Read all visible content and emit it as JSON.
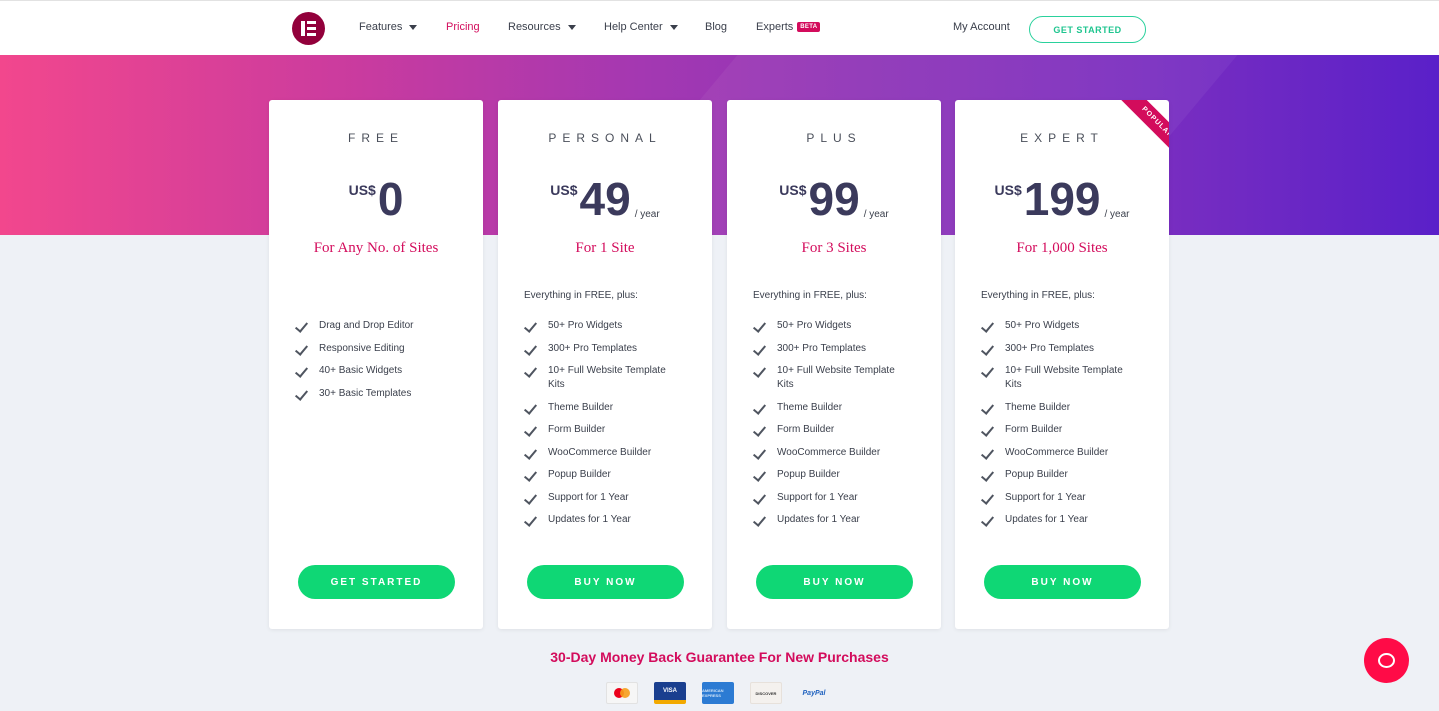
{
  "header": {
    "nav": [
      {
        "label": "Features",
        "dropdown": true
      },
      {
        "label": "Pricing",
        "active": true
      },
      {
        "label": "Resources",
        "dropdown": true
      },
      {
        "label": "Help Center",
        "dropdown": true
      },
      {
        "label": "Blog"
      },
      {
        "label": "Experts",
        "badge": "BETA"
      }
    ],
    "account": "My Account",
    "cta": "GET STARTED"
  },
  "plans": [
    {
      "name": "FREE",
      "currency": "US$",
      "amount": "0",
      "period": "",
      "sites": "For Any No. of Sites",
      "intro": "",
      "features": [
        "Drag and Drop Editor",
        "Responsive Editing",
        "40+ Basic Widgets",
        "30+ Basic Templates"
      ],
      "button": "GET STARTED"
    },
    {
      "name": "PERSONAL",
      "currency": "US$",
      "amount": "49",
      "period": "/ year",
      "sites": "For 1 Site",
      "intro": "Everything in FREE, plus:",
      "features": [
        "50+ Pro Widgets",
        "300+ Pro Templates",
        "10+ Full Website Template Kits",
        "Theme Builder",
        "Form Builder",
        "WooCommerce Builder",
        "Popup Builder",
        "Support for 1 Year",
        "Updates for 1 Year"
      ],
      "button": "BUY NOW"
    },
    {
      "name": "PLUS",
      "currency": "US$",
      "amount": "99",
      "period": "/ year",
      "sites": "For 3 Sites",
      "intro": "Everything in FREE, plus:",
      "features": [
        "50+ Pro Widgets",
        "300+ Pro Templates",
        "10+ Full Website Template Kits",
        "Theme Builder",
        "Form Builder",
        "WooCommerce Builder",
        "Popup Builder",
        "Support for 1 Year",
        "Updates for 1 Year"
      ],
      "button": "BUY NOW"
    },
    {
      "name": "EXPERT",
      "currency": "US$",
      "amount": "199",
      "period": "/ year",
      "sites": "For 1,000 Sites",
      "intro": "Everything in FREE, plus:",
      "features": [
        "50+ Pro Widgets",
        "300+ Pro Templates",
        "10+ Full Website Template Kits",
        "Theme Builder",
        "Form Builder",
        "WooCommerce Builder",
        "Popup Builder",
        "Support for 1 Year",
        "Updates for 1 Year"
      ],
      "button": "BUY NOW",
      "ribbon": "POPULAR"
    }
  ],
  "guarantee": "30-Day Money Back Guarantee For New Purchases",
  "payments": [
    {
      "name": "mastercard-icon",
      "label": ""
    },
    {
      "name": "visa-icon",
      "label": "VISA"
    },
    {
      "name": "american-express-icon",
      "label": "AMERICAN EXPRESS"
    },
    {
      "name": "discover-icon",
      "label": "DISCOVER"
    },
    {
      "name": "paypal-icon",
      "label": "PayPal"
    }
  ],
  "colors": {
    "accent": "#d30c5c",
    "cta": "#0fd775",
    "outline": "#2ad19c",
    "chat": "#ff0b47"
  }
}
